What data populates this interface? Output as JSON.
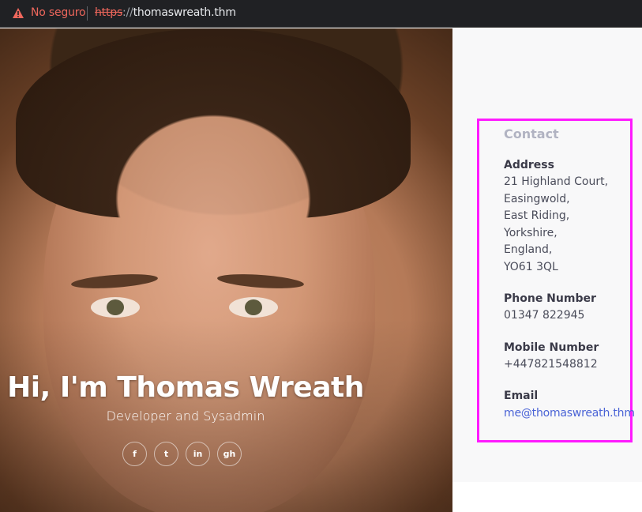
{
  "browser": {
    "security_label": "No seguro",
    "url_scheme": "https",
    "url_separator": "://",
    "url_host": "thomaswreath.thm",
    "warning_color": "#ee675c"
  },
  "hero": {
    "title": "Hi, I'm Thomas Wreath",
    "subtitle": "Developer and Sysadmin",
    "socials": [
      {
        "icon": "facebook-icon",
        "glyph": "f"
      },
      {
        "icon": "twitter-icon",
        "glyph": "t"
      },
      {
        "icon": "linkedin-icon",
        "glyph": "in"
      },
      {
        "icon": "github-icon",
        "glyph": "gh"
      }
    ]
  },
  "contact": {
    "title": "Contact",
    "address_label": "Address",
    "address_lines": [
      "21 Highland Court,",
      "Easingwold,",
      "East Riding,",
      "Yorkshire,",
      "England,",
      "YO61 3QL"
    ],
    "phone_label": "Phone Number",
    "phone": "01347 822945",
    "mobile_label": "Mobile Number",
    "mobile": "+447821548812",
    "email_label": "Email",
    "email": "me@thomaswreath.thm",
    "highlight_color": "#ff1aff",
    "link_color": "#4a63d6"
  }
}
